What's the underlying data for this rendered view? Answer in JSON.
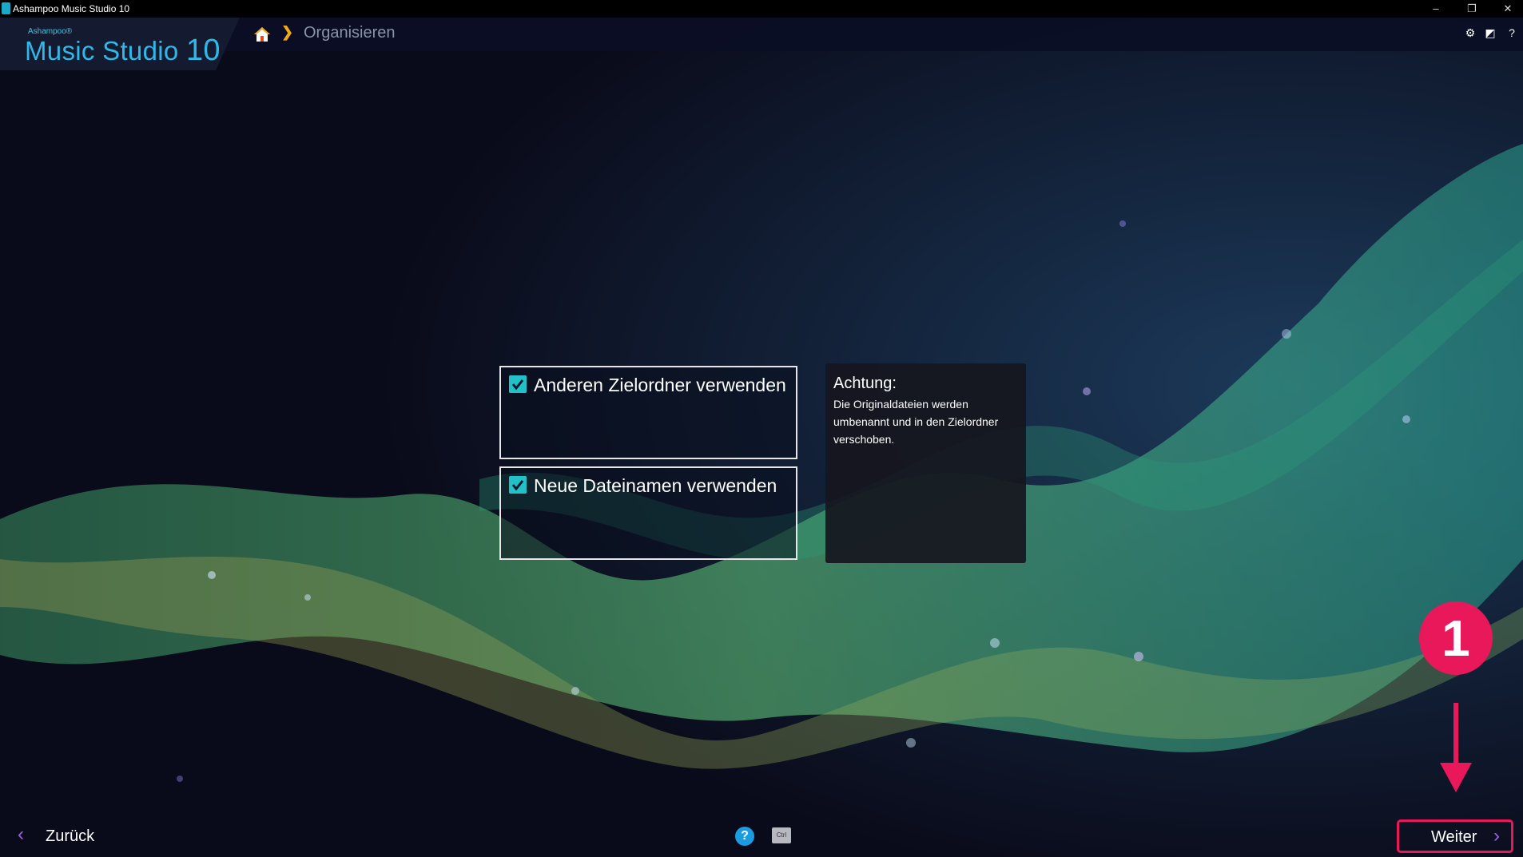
{
  "window": {
    "title": "Ashampoo Music Studio 10",
    "controls": {
      "minimize": "–",
      "restore": "❐",
      "close": "✕"
    }
  },
  "brand": {
    "vendor": "Ashampoo®",
    "product": "Music Studio",
    "version": "10"
  },
  "breadcrumb": {
    "home_icon": "home-icon",
    "separator": "❯",
    "current": "Organisieren"
  },
  "header_icons": {
    "settings": "⚙",
    "display": "◩",
    "help": "?"
  },
  "options": [
    {
      "label": "Anderen Zielordner verwenden",
      "checked": true
    },
    {
      "label": "Neue Dateinamen verwenden",
      "checked": true
    }
  ],
  "note": {
    "title": "Achtung:",
    "text": "Die Originaldateien werden umbenannt und in den Zielordner verschoben."
  },
  "footer": {
    "back_chevron": "‹",
    "back_label": "Zurück",
    "help": "?",
    "ctrl": "Ctrl",
    "next_label": "Weiter",
    "next_chevron": "›"
  },
  "annotation": {
    "badge": "1"
  },
  "colors": {
    "accent": "#22c0c8",
    "highlight": "#e8185a",
    "chevron": "#9f62e8",
    "breadcrumb_sep": "#f0a81c"
  }
}
